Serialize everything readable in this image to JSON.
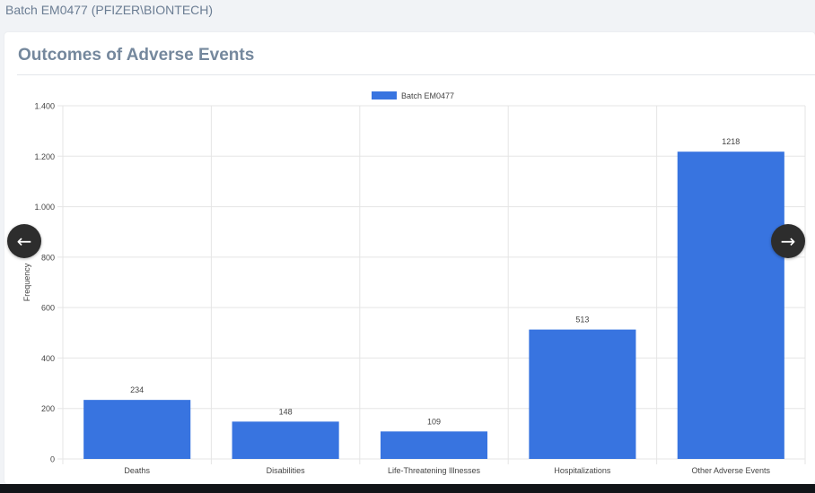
{
  "header": {
    "batch_title": "Batch EM0477 (PFIZER\\BIONTECH)"
  },
  "card": {
    "title": "Outcomes of Adverse Events"
  },
  "navigation": {
    "prev_icon": "arrow-left-icon",
    "next_icon": "arrow-right-icon"
  },
  "colors": {
    "bar": "#3874e0",
    "grid": "#e5e5e5",
    "text": "#444444"
  },
  "chart_data": {
    "type": "bar",
    "categories": [
      "Deaths",
      "Disabilities",
      "Life-Threatening Illnesses",
      "Hospitalizations",
      "Other Adverse Events"
    ],
    "series": [
      {
        "name": "Batch EM0477",
        "values": [
          234,
          148,
          109,
          513,
          1218
        ]
      }
    ],
    "data_labels": [
      "234",
      "148",
      "109",
      "513",
      "1218"
    ],
    "xlabel": "",
    "ylabel": "Frequency",
    "ylim": [
      0,
      1400
    ],
    "yticks": [
      0,
      200,
      400,
      600,
      800,
      1000,
      1200,
      1400
    ],
    "ytick_labels": [
      "0",
      "200",
      "400",
      "600",
      "800",
      "1.000",
      "1.200",
      "1.400"
    ],
    "grid": true,
    "legend": "top-center"
  }
}
